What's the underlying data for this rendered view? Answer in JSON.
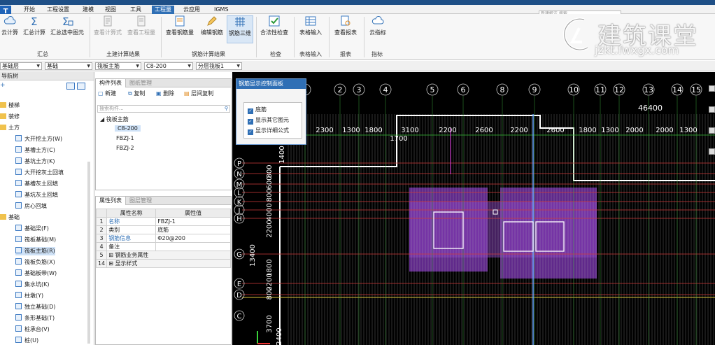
{
  "app": {
    "tabs": [
      "开始",
      "工程设置",
      "建模",
      "视图",
      "工具",
      "工程量",
      "云应用",
      "IGMS"
    ],
    "active_tab": "工程量",
    "search_placeholder": "新建解法  搜索"
  },
  "ribbon": {
    "buttons": [
      {
        "label": "云计算",
        "state": "normal"
      },
      {
        "label": "汇总计算",
        "state": "normal"
      },
      {
        "label": "汇总选中图元",
        "state": "normal"
      },
      {
        "label": "查看计算式",
        "state": "disabled"
      },
      {
        "label": "查看工程量",
        "state": "disabled"
      },
      {
        "label": "查看钢筋量",
        "state": "normal"
      },
      {
        "label": "编辑钢筋",
        "state": "normal"
      },
      {
        "label": "钢筋三维",
        "state": "selected"
      },
      {
        "label": "合法性检查",
        "state": "normal"
      },
      {
        "label": "表格输入",
        "state": "normal"
      },
      {
        "label": "查看报表",
        "state": "normal"
      },
      {
        "label": "云指标",
        "state": "normal"
      }
    ],
    "groups": [
      "汇总",
      "土建计算结果",
      "钢筋计算结果",
      "检查",
      "表格输入",
      "报表",
      "指标"
    ]
  },
  "selectors": {
    "floor": "基础层",
    "category": "基础",
    "component_type": "筏板主筋",
    "component": "C8-200",
    "layer": "分层筏板1"
  },
  "nav": {
    "title": "导航树",
    "items": [
      {
        "label": "楼梯",
        "type": "group"
      },
      {
        "label": "装修",
        "type": "group"
      },
      {
        "label": "土方",
        "type": "group"
      },
      {
        "label": "大开挖土方(W)",
        "type": "item"
      },
      {
        "label": "基槽土方(C)",
        "type": "item"
      },
      {
        "label": "基坑土方(K)",
        "type": "item"
      },
      {
        "label": "大开挖灰土回填",
        "type": "item"
      },
      {
        "label": "基槽灰土回填",
        "type": "item"
      },
      {
        "label": "基坑灰土回填",
        "type": "item"
      },
      {
        "label": "房心回填",
        "type": "item"
      },
      {
        "label": "基础",
        "type": "group"
      },
      {
        "label": "基础梁(F)",
        "type": "item"
      },
      {
        "label": "筏板基础(M)",
        "type": "item"
      },
      {
        "label": "筏板主筋(R)",
        "type": "item",
        "selected": true
      },
      {
        "label": "筏板负筋(X)",
        "type": "item"
      },
      {
        "label": "基础板带(W)",
        "type": "item"
      },
      {
        "label": "集水坑(K)",
        "type": "item"
      },
      {
        "label": "柱墩(Y)",
        "type": "item"
      },
      {
        "label": "独立基础(D)",
        "type": "item"
      },
      {
        "label": "条形基础(T)",
        "type": "item"
      },
      {
        "label": "桩承台(V)",
        "type": "item"
      },
      {
        "label": "桩(U)",
        "type": "item"
      }
    ]
  },
  "component_panel": {
    "tabs": [
      "构件列表",
      "图纸管理"
    ],
    "toolbar": [
      "新建",
      "复制",
      "删除",
      "层间复制"
    ],
    "search_placeholder": "搜索构件...",
    "tree_root": "筏板主筋",
    "items": [
      "C8-200",
      "FBZJ-1",
      "FBZJ-2"
    ],
    "selected": "C8-200"
  },
  "property_panel": {
    "tabs": [
      "属性列表",
      "图层管理"
    ],
    "header": [
      "属性名称",
      "属性值"
    ],
    "rows": [
      {
        "n": "1",
        "key": "名称",
        "val": "FBZJ-1"
      },
      {
        "n": "2",
        "key": "类别",
        "val": "底筋"
      },
      {
        "n": "3",
        "key": "钢筋信息",
        "val": "Φ20@200"
      },
      {
        "n": "4",
        "key": "备注",
        "val": ""
      },
      {
        "n": "5",
        "key": "钢筋业务属性",
        "val": ""
      },
      {
        "n": "14",
        "key": "显示样式",
        "val": ""
      }
    ]
  },
  "dialog": {
    "title": "钢筋显示控制面板",
    "options": [
      {
        "label": "底筋",
        "checked": true
      },
      {
        "label": "显示其它图元",
        "checked": true
      },
      {
        "label": "显示详细公式",
        "checked": true
      }
    ]
  },
  "drawing": {
    "axis_numbers": [
      "1",
      "2",
      "3",
      "4",
      "5",
      "6",
      "8",
      "9",
      "10",
      "11",
      "12",
      "13",
      "14",
      "15"
    ],
    "axis_letters": [
      "P",
      "N",
      "M",
      "L",
      "K",
      "J",
      "H",
      "G",
      "E",
      "D",
      "C"
    ],
    "top_dimension": "46400",
    "dims_top": [
      "2300",
      "1300",
      "1800",
      "3100",
      "1700",
      "2200",
      "2600",
      "2200",
      "2600",
      "1800",
      "1300",
      "2000",
      "2000",
      "1300"
    ],
    "dims_left": [
      "1400",
      "800",
      "600",
      "800",
      "4000",
      "2200",
      "13400",
      "1800",
      "2200",
      "800",
      "3700",
      "2400"
    ]
  },
  "watermark": {
    "title": "建筑课堂",
    "url": "jzkt.fwxgx.com"
  }
}
